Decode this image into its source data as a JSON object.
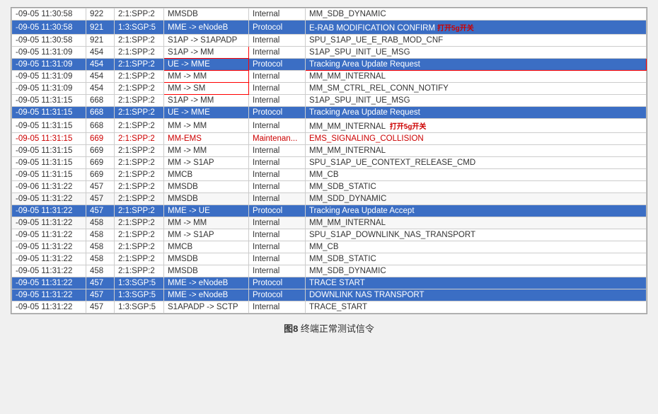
{
  "table": {
    "rows": [
      {
        "time": "-09-05 11:30:58",
        "id": "922",
        "node": "2:1:SPP:2",
        "from": "MMSDB",
        "type": "Internal",
        "msg": "MM_SDB_DYNAMIC",
        "style": "normal"
      },
      {
        "time": "-09-05 11:30:58",
        "id": "921",
        "node": "1:3:SGP:5",
        "from": "MME -> eNodeB",
        "type": "Protocol",
        "msg": "E-RAB MODIFICATION CONFIRM",
        "style": "blue",
        "annot": "打开5g开关"
      },
      {
        "time": "-09-05 11:30:58",
        "id": "921",
        "node": "2:1:SPP:2",
        "from": "S1AP -> S1APADP",
        "type": "Internal",
        "msg": "SPU_S1AP_UE_E_RAB_MOD_CNF",
        "style": "normal"
      },
      {
        "time": "-09-05 11:31:09",
        "id": "454",
        "node": "2:1:SPP:2",
        "from": "S1AP -> MM",
        "type": "Internal",
        "msg": "S1AP_SPU_INIT_UE_MSG",
        "style": "normal",
        "outline_from": true
      },
      {
        "time": "-09-05 11:31:09",
        "id": "454",
        "node": "2:1:SPP:2",
        "from": "UE -> MME",
        "type": "Protocol",
        "msg": "Tracking Area Update Request",
        "style": "blue",
        "outline_msg": true
      },
      {
        "time": "-09-05 11:31:09",
        "id": "454",
        "node": "2:1:SPP:2",
        "from": "MM -> MM",
        "type": "Internal",
        "msg": "MM_MM_INTERNAL",
        "style": "normal"
      },
      {
        "time": "-09-05 11:31:09",
        "id": "454",
        "node": "2:1:SPP:2",
        "from": "MM -> SM",
        "type": "Internal",
        "msg": "MM_SM_CTRL_REL_CONN_NOTIFY",
        "style": "normal"
      },
      {
        "time": "-09-05 11:31:15",
        "id": "668",
        "node": "2:1:SPP:2",
        "from": "S1AP -> MM",
        "type": "Internal",
        "msg": "S1AP_SPU_INIT_UE_MSG",
        "style": "normal"
      },
      {
        "time": "-09-05 11:31:15",
        "id": "668",
        "node": "2:1:SPP:2",
        "from": "UE -> MME",
        "type": "Protocol",
        "msg": "Tracking Area Update Request",
        "style": "blue"
      },
      {
        "time": "-09-05 11:31:15",
        "id": "668",
        "node": "2:1:SPP:2",
        "from": "MM -> MM",
        "type": "Internal",
        "msg": "MM_MM_INTERNAL",
        "style": "normal",
        "annot2": "打开5g开关"
      },
      {
        "time": "-09-05 11:31:15",
        "id": "669",
        "node": "2:1:SPP:2",
        "from": "MM-EMS",
        "type": "Maintenan...",
        "msg": "EMS_SIGNALING_COLLISION",
        "style": "red-text"
      },
      {
        "time": "-09-05 11:31:15",
        "id": "669",
        "node": "2:1:SPP:2",
        "from": "MM -> MM",
        "type": "Internal",
        "msg": "MM_MM_INTERNAL",
        "style": "normal"
      },
      {
        "time": "-09-05 11:31:15",
        "id": "669",
        "node": "2:1:SPP:2",
        "from": "MM -> S1AP",
        "type": "Internal",
        "msg": "SPU_S1AP_UE_CONTEXT_RELEASE_CMD",
        "style": "normal"
      },
      {
        "time": "-09-05 11:31:15",
        "id": "669",
        "node": "2:1:SPP:2",
        "from": "MMCB",
        "type": "Internal",
        "msg": "MM_CB",
        "style": "normal"
      },
      {
        "time": "-09-06 11:31:22",
        "id": "457",
        "node": "2:1:SPP:2",
        "from": "MMSDB",
        "type": "Internal",
        "msg": "MM_SDB_STATIC",
        "style": "normal"
      },
      {
        "time": "-09-05 11:31:22",
        "id": "457",
        "node": "2:1:SPP:2",
        "from": "MMSDB",
        "type": "Internal",
        "msg": "MM_SDD_DYNAMIC",
        "style": "striped"
      },
      {
        "time": "-09-05 11:31:22",
        "id": "457",
        "node": "2:1:SPP:2",
        "from": "MME -> UE",
        "type": "Protocol",
        "msg": "Tracking Area Update Accept",
        "style": "blue"
      },
      {
        "time": "-09-05 11:31:22",
        "id": "458",
        "node": "2:1:SPP:2",
        "from": "MM -> MM",
        "type": "Internal",
        "msg": "MM_MM_INTERNAL",
        "style": "striped"
      },
      {
        "time": "-09-05 11:31:22",
        "id": "458",
        "node": "2:1:SPP:2",
        "from": "MM -> S1AP",
        "type": "Internal",
        "msg": "SPU_S1AP_DOWNLINK_NAS_TRANSPORT",
        "style": "normal"
      },
      {
        "time": "-09-05 11:31:22",
        "id": "458",
        "node": "2:1:SPP:2",
        "from": "MMCB",
        "type": "Internal",
        "msg": "MM_CB",
        "style": "normal"
      },
      {
        "time": "-09-05 11:31:22",
        "id": "458",
        "node": "2:1:SPP:2",
        "from": "MMSDB",
        "type": "Internal",
        "msg": "MM_SDB_STATIC",
        "style": "normal"
      },
      {
        "time": "-09-05 11:31:22",
        "id": "458",
        "node": "2:1:SPP:2",
        "from": "MMSDB",
        "type": "Internal",
        "msg": "MM_SDB_DYNAMIC",
        "style": "normal"
      },
      {
        "time": "-09-05 11:31:22",
        "id": "457",
        "node": "1:3:SGP:5",
        "from": "MME -> eNodeB",
        "type": "Protocol",
        "msg": "TRACE START",
        "style": "blue"
      },
      {
        "time": "-09-05 11:31:22",
        "id": "457",
        "node": "1:3:SGP:5",
        "from": "MME -> eNodeB",
        "type": "Protocol",
        "msg": "DOWNLINK NAS TRANSPORT",
        "style": "blue"
      },
      {
        "time": "-09-05 11:31:22",
        "id": "457",
        "node": "1:3:SGP:5",
        "from": "S1APADP -> SCTP",
        "type": "Internal",
        "msg": "TRACE_START",
        "style": "normal"
      }
    ]
  },
  "caption": {
    "fig_num": "图8",
    "text": "  终端正常测试信令"
  }
}
